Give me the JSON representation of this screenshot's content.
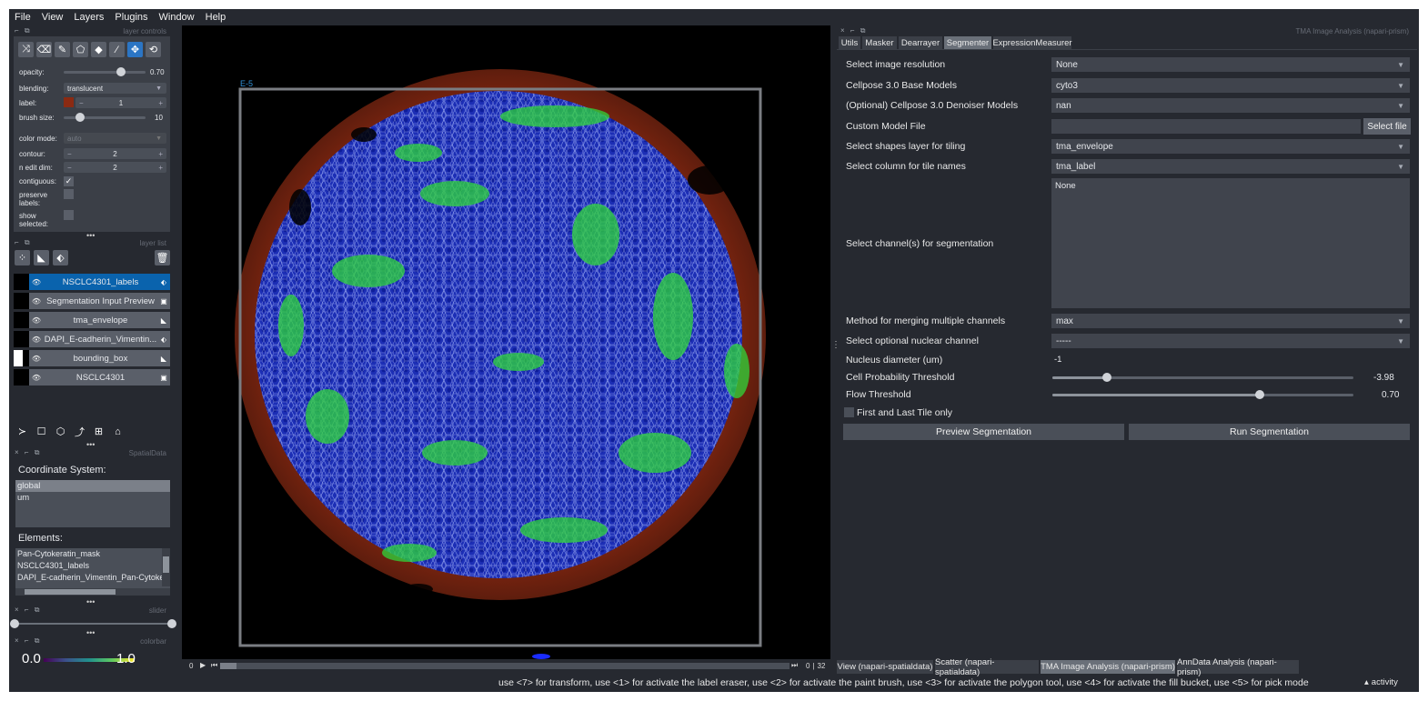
{
  "menu": [
    "File",
    "View",
    "Layers",
    "Plugins",
    "Window",
    "Help"
  ],
  "layer_controls": {
    "header": "layer controls",
    "opacity_label": "opacity:",
    "opacity_value": "0.70",
    "opacity_fraction": 0.7,
    "blending_label": "blending:",
    "blending_value": "translucent",
    "label_label": "label:",
    "label_value": "1",
    "brush_label": "brush size:",
    "brush_value": "10",
    "brush_fraction": 0.2,
    "colormode_label": "color mode:",
    "colormode_value": "auto",
    "contour_label": "contour:",
    "contour_value": "2",
    "nedit_label": "n edit dim:",
    "nedit_value": "2",
    "contiguous_label": "contiguous:",
    "preserve_label_1": "preserve",
    "preserve_label_2": "labels:",
    "show_label_1": "show",
    "show_label_2": "selected:",
    "minus": "−",
    "plus": "+"
  },
  "layer_list": {
    "header": "layer list",
    "layers": [
      {
        "name": "NSCLC4301_labels",
        "type": "labels",
        "selected": true
      },
      {
        "name": "Segmentation Input Preview",
        "type": "image",
        "selected": false
      },
      {
        "name": "tma_envelope",
        "type": "shapes",
        "selected": false
      },
      {
        "name": "DAPI_E-cadherin_Vimentin...",
        "type": "labels",
        "selected": false
      },
      {
        "name": "bounding_box",
        "type": "shapes",
        "selected": false
      },
      {
        "name": "NSCLC4301",
        "type": "image",
        "selected": false
      }
    ]
  },
  "spatialdata": {
    "header": "SpatialData",
    "coord_title": "Coordinate System:",
    "coord_items": [
      "global",
      "um"
    ],
    "elements_title": "Elements:",
    "elements": [
      "Pan-Cytokeratin_mask",
      "NSCLC4301_labels",
      "DAPI_E-cadherin_Vimentin_Pan-Cytoke"
    ]
  },
  "slider_header": "slider",
  "colorbar": {
    "header": "colorbar",
    "min": "0.0",
    "max": "1.0"
  },
  "canvas": {
    "tile_label": "E-5",
    "frame_current": "0",
    "frame_total": "32"
  },
  "plugin": {
    "header": "TMA Image Analysis (napari-prism)",
    "tabs": [
      {
        "label": "Utils",
        "active": false
      },
      {
        "label": "Masker",
        "active": false
      },
      {
        "label": "Dearrayer",
        "active": false
      },
      {
        "label": "Segmenter",
        "active": true
      },
      {
        "label": "ExpressionMeasurer",
        "active": false
      }
    ],
    "fields": {
      "resolution_label": "Select image resolution",
      "resolution_value": "None",
      "base_label": "Cellpose 3.0 Base Models",
      "base_value": "cyto3",
      "denoiser_label": "(Optional) Cellpose 3.0 Denoiser Models",
      "denoiser_value": "nan",
      "custom_label": "Custom Model File",
      "select_file": "Select file",
      "shapes_label": "Select shapes layer for tiling",
      "shapes_value": "tma_envelope",
      "column_label": "Select column for tile names",
      "column_value": "tma_label",
      "channels_label": "Select channel(s) for segmentation",
      "channels_value": "None",
      "merge_label": "Method for merging multiple channels",
      "merge_value": "max",
      "nuclear_label": "Select optional nuclear channel",
      "nuclear_value": "-----",
      "diameter_label": "Nucleus diameter (um)",
      "diameter_value": "-1",
      "prob_label": "Cell Probability Threshold",
      "prob_value": "-3.98",
      "prob_fraction": 0.18,
      "flow_label": "Flow Threshold",
      "flow_value": "0.70",
      "flow_fraction": 0.69,
      "firstlast_label": "First and Last Tile only"
    },
    "preview_button": "Preview Segmentation",
    "run_button": "Run Segmentation"
  },
  "bottom_tabs": [
    {
      "label": "View (napari-spatialdata)",
      "active": false
    },
    {
      "label": "Scatter (napari-spatialdata)",
      "active": false
    },
    {
      "label": "TMA Image Analysis (napari-prism)",
      "active": true
    },
    {
      "label": "AnnData Analysis (napari-prism)",
      "active": false
    }
  ],
  "status": {
    "message": "use <7> for transform, use <1> for activate the label eraser, use <2> for activate the paint brush, use <3> for activate the polygon tool, use <4> for activate the fill bucket, use <5> for pick mode",
    "activity": "activity"
  },
  "colors": {
    "accent": "#0a63ad",
    "panel": "#3b3f47",
    "background": "#262930",
    "label_color": "#8b2a12"
  }
}
